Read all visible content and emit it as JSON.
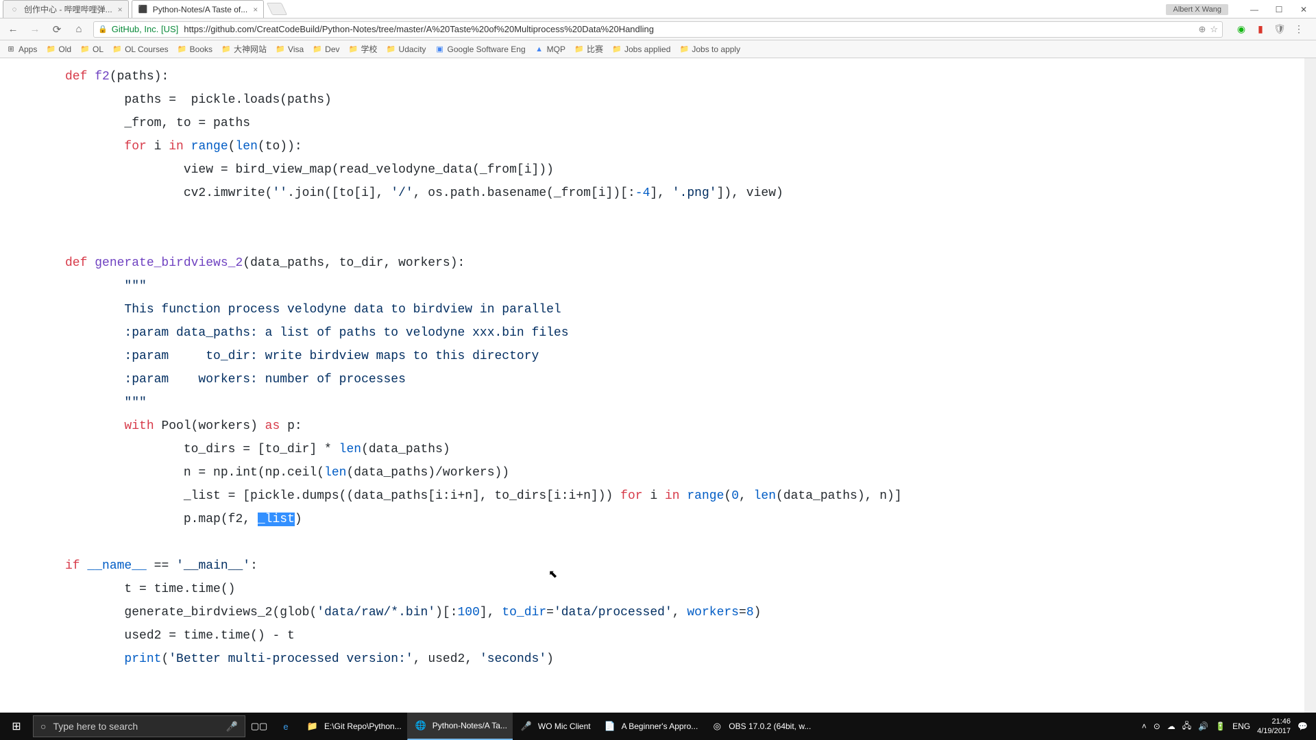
{
  "window": {
    "user_badge": "Albert X Wang",
    "tabs": [
      {
        "title": "创作中心 - 哔哩哔哩弹...",
        "active": false
      },
      {
        "title": "Python-Notes/A Taste of...",
        "active": true
      }
    ],
    "minimize": "—",
    "maximize": "☐",
    "close": "✕"
  },
  "addressbar": {
    "secure_prefix": "GitHub, Inc. [US]",
    "url": "https://github.com/CreatCodeBuild/Python-Notes/tree/master/A%20Taste%20of%20Multiprocess%20Data%20Handling",
    "zoom_icon": "⊕",
    "star_icon": "☆"
  },
  "bookmarks": {
    "apps": "Apps",
    "items": [
      "Old",
      "OL",
      "OL Courses",
      "Books",
      "大神网站",
      "Visa",
      "Dev",
      "学校",
      "Udacity",
      "Google Software Eng",
      "MQP",
      "比赛",
      "Jobs applied",
      "Jobs to apply"
    ]
  },
  "code": {
    "def": "def",
    "for": "for",
    "in": "in",
    "with": "with",
    "as": "as",
    "if": "if",
    "f2_name": "f2",
    "f2_params": "(paths):",
    "l1": "        paths =  pickle.loads(paths)",
    "l2": "        _from, to = paths",
    "l3a": "        ",
    "l3b": " i ",
    "l3c": " ",
    "range": "range",
    "len": "len",
    "l3d": "(",
    "l3e": "(to)):",
    "l4": "                view = bird_view_map(read_velodyne_data(_from[i]))",
    "l5a": "                cv2.imwrite(",
    "l5b": "''",
    "l5c": ".join([to[i], ",
    "l5d": "'/'",
    "l5e": ", os.path.basename(_from[i])[:",
    "neg4": "-4",
    "l5f": "], ",
    "l5g": "'.png'",
    "l5h": "]), view)",
    "gen_name": "generate_birdviews_2",
    "gen_params": "(data_paths, to_dir, workers):",
    "doc1": "        \"\"\"",
    "doc2": "        This function process velodyne data to birdview in parallel",
    "doc3": "        :param data_paths: a list of paths to velodyne xxx.bin files",
    "doc4": "        :param     to_dir: write birdview maps to this directory",
    "doc5": "        :param    workers: number of processes",
    "doc6": "        \"\"\"",
    "w1": "        ",
    "w2": " Pool(workers) ",
    "w3": " p:",
    "w4": "                to_dirs = [to_dir] * ",
    "w5": "(data_paths)",
    "w6": "                n = np.int(np.ceil(",
    "w7": "(data_paths)/workers))",
    "w8": "                _list = [pickle.dumps((data_paths[i:i+n], to_dirs[i:i+n])) ",
    "w9": " i ",
    "w10": " ",
    "zero": "0",
    "w11": "(",
    "w12": ", ",
    "w13": "(data_paths), n)]",
    "w14": "                p.map(f2, ",
    "hl_list": "_list",
    "w15": ")",
    "name_dunder": "__name__",
    "eq": " == ",
    "main_str": "'__main__'",
    "colon": ":",
    "m1": "        t = time.time()",
    "m2a": "        generate_birdviews_2(glob(",
    "m2b": "'data/raw/*.bin'",
    "m2c": ")[:",
    "hundred": "100",
    "m2d": "], ",
    "to_dir_kw": "to_dir",
    "m2e": "=",
    "m2f": "'data/processed'",
    "m2g": ", ",
    "workers_kw": "workers",
    "m2h": "=",
    "eight": "8",
    "m2i": ")",
    "m3": "        used2 = time.time() - t",
    "print": "print",
    "m4a": "        ",
    "m4b": "(",
    "m4c": "'Better multi-processed version:'",
    "m4d": ", used2, ",
    "m4e": "'seconds'",
    "m4f": ")"
  },
  "taskbar": {
    "search_placeholder": "Type here to search",
    "items": [
      {
        "label": "E:\\Git Repo\\Python...",
        "icon": "📁"
      },
      {
        "label": "Python-Notes/A Ta...",
        "icon": "🌐",
        "active": true
      },
      {
        "label": "WO Mic Client",
        "icon": "🎤"
      },
      {
        "label": "A Beginner's Appro...",
        "icon": "📄"
      },
      {
        "label": "OBS 17.0.2 (64bit, w...",
        "icon": "◎"
      }
    ],
    "tray": {
      "lang": "ENG",
      "time": "21:46",
      "date": "4/19/2017"
    }
  }
}
